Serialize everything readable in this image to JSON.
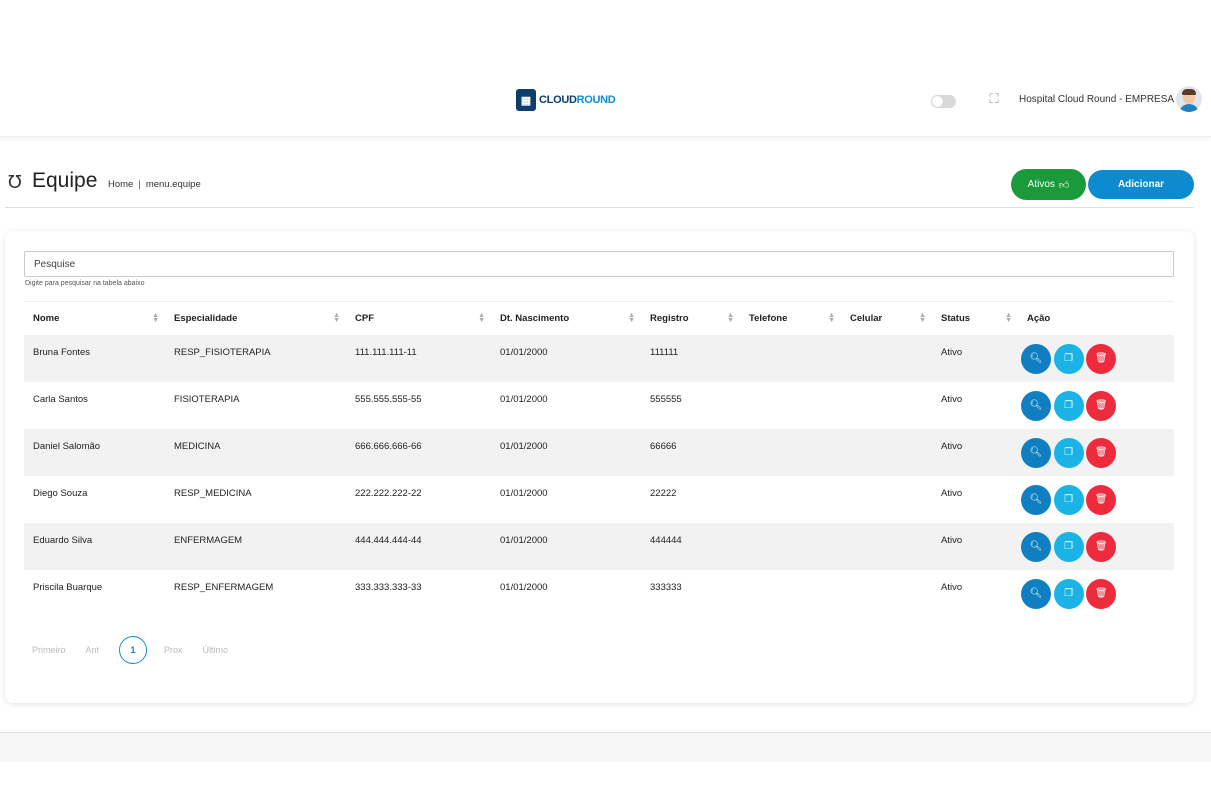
{
  "header": {
    "logo_part1": "CLOUD",
    "logo_part2": "ROUND",
    "company": "Hospital Cloud Round - EMPRESA",
    "colors": {
      "brand_dark": "#0c3d6b",
      "brand_light": "#0e8ed0"
    }
  },
  "page": {
    "title": "Equipe",
    "breadcrumb_home": "Home",
    "breadcrumb_sep": "|",
    "breadcrumb_current": "menu.equipe",
    "btn_ativos": "Ativos",
    "btn_add": "Adicionar"
  },
  "search": {
    "placeholder": "Pesquise",
    "hint": "Digite para pesquisar na tabela abaixo"
  },
  "table": {
    "columns": [
      "Nome",
      "Especialidade",
      "CPF",
      "Dt. Nascimento",
      "Registro",
      "Telefone",
      "Celular",
      "Status",
      "Ação"
    ],
    "rows": [
      [
        "Bruna Fontes",
        "RESP_FISIOTERAPIA",
        "111.111.111-11",
        "01/01/2000",
        "111111",
        "",
        "",
        "Ativo"
      ],
      [
        "Carla Santos",
        "FISIOTERAPIA",
        "555.555.555-55",
        "01/01/2000",
        "555555",
        "",
        "",
        "Ativo"
      ],
      [
        "Daniel Salomão",
        "MEDICINA",
        "666.666.666-66",
        "01/01/2000",
        "66666",
        "",
        "",
        "Ativo"
      ],
      [
        "Diego Souza",
        "RESP_MEDICINA",
        "222.222.222-22",
        "01/01/2000",
        "22222",
        "",
        "",
        "Ativo"
      ],
      [
        "Eduardo Silva",
        "ENFERMAGEM",
        "444.444.444-44",
        "01/01/2000",
        "444444",
        "",
        "",
        "Ativo"
      ],
      [
        "Priscila Buarque",
        "RESP_ENFERMAGEM",
        "333.333.333-33",
        "01/01/2000",
        "333333",
        "",
        "",
        "Ativo"
      ]
    ]
  },
  "pagination": {
    "first": "Primeiro",
    "prev": "Ant",
    "current": "1",
    "next": "Prox",
    "last": "Último"
  }
}
